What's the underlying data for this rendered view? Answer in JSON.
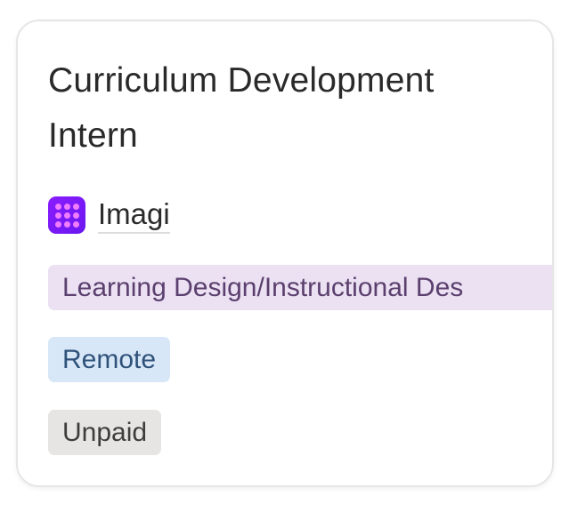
{
  "job_card": {
    "title": "Curriculum Development Intern",
    "company": {
      "name": "Imagi",
      "logo_icon": "imagi-grid-logo-icon",
      "logo_color": "#7a1af7"
    },
    "tags": {
      "category": "Learning Design/Instructional Des",
      "location": "Remote",
      "pay": "Unpaid"
    },
    "tag_colors": {
      "category_bg": "#ebe1f2",
      "location_bg": "#d8e7f7",
      "pay_bg": "#e6e5e3"
    }
  }
}
